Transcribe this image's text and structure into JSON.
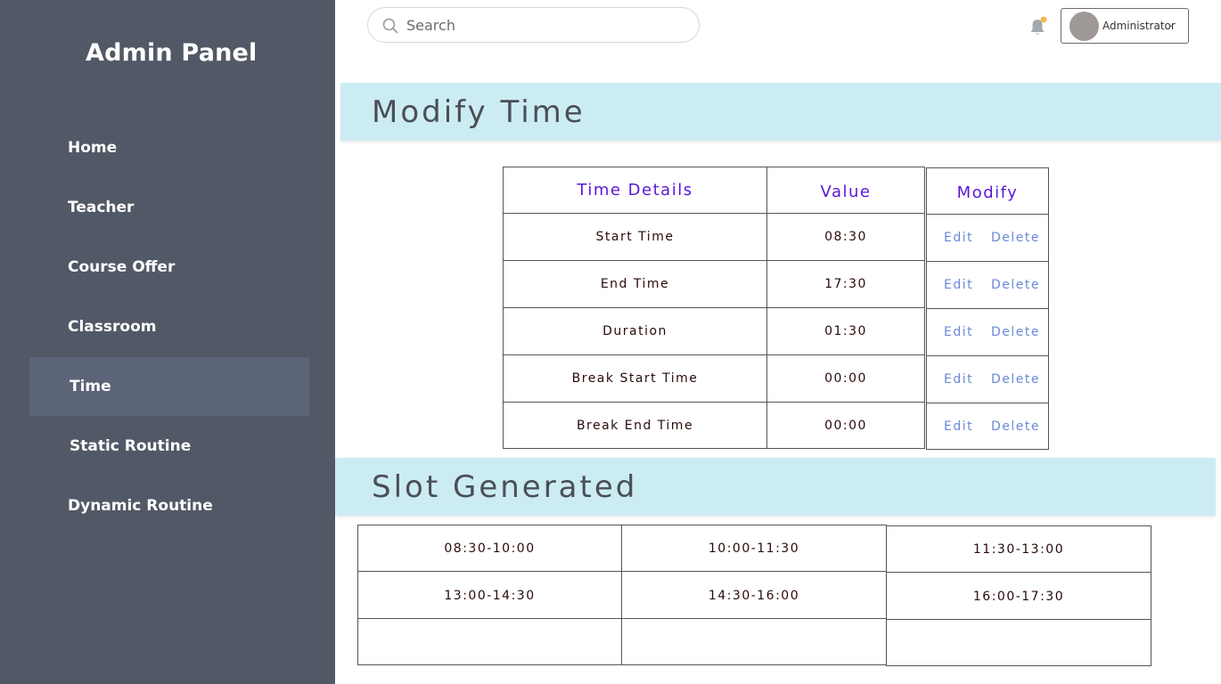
{
  "sidebar": {
    "brand": "Admin Panel",
    "items": [
      {
        "label": "Home"
      },
      {
        "label": "Teacher"
      },
      {
        "label": "Course Offer"
      },
      {
        "label": "Classroom"
      },
      {
        "label": "Time",
        "active": true
      },
      {
        "label": "Static Routine"
      },
      {
        "label": "Dynamic Routine"
      }
    ]
  },
  "header": {
    "search_placeholder": "Search",
    "search_value": "",
    "notification_badge_color": "#f0b84a",
    "user": {
      "name": "Administrator"
    }
  },
  "colors": {
    "sidebar_bg": "#525966",
    "active_item_bg": "#5c6578",
    "banner_bg": "#ccecf3",
    "header_text": "#5a17d6",
    "action_link": "#6a89d8"
  },
  "modify_section": {
    "title": "Modify Time",
    "columns": [
      "Time Details",
      "Value",
      "Modify"
    ],
    "rows": [
      {
        "detail": "Start Time",
        "value": "08:30",
        "edit": "Edit",
        "delete": "Delete"
      },
      {
        "detail": "End  Time",
        "value": "17:30",
        "edit": "Edit",
        "delete": "Delete"
      },
      {
        "detail": "Duration",
        "value": "01:30",
        "edit": "Edit",
        "delete": "Delete"
      },
      {
        "detail": "Break Start Time",
        "value": "00:00",
        "edit": "Edit",
        "delete": "Delete"
      },
      {
        "detail": "Break End Time",
        "value": "00:00",
        "edit": "Edit",
        "delete": "Delete"
      }
    ]
  },
  "slot_section": {
    "title": "Slot Generated",
    "slots": [
      [
        "08:30-10:00",
        "10:00-11:30",
        "11:30-13:00"
      ],
      [
        "13:00-14:30",
        "14:30-16:00",
        "16:00-17:30"
      ],
      [
        "",
        "",
        ""
      ]
    ]
  }
}
